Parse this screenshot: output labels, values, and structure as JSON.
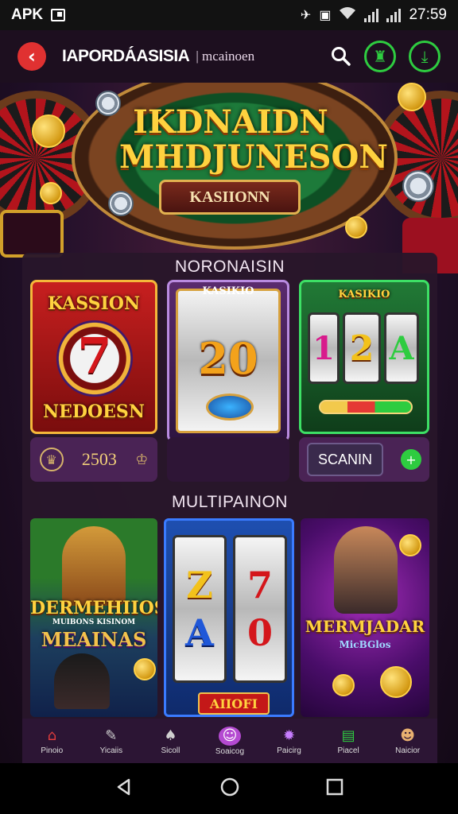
{
  "status_bar": {
    "carrier": "APK",
    "time": "27:59"
  },
  "app_bar": {
    "title": "IAPORDÁASISIA",
    "subtitle": "| mcainoen"
  },
  "hero": {
    "title_line1": "IKDNAIDN",
    "title_line2": "MHDJUNESON",
    "plaque_label": "KASIIONN"
  },
  "section1": {
    "title": "NORONAISIN",
    "card1": {
      "top_label": "KASSION",
      "digit": "7",
      "bottom_label": "NEDOESN"
    },
    "card2": {
      "top_label": "KASIKIO",
      "number": "20"
    },
    "card3": {
      "top_label": "KASIKIO",
      "digits": [
        "1",
        "2",
        "A"
      ]
    },
    "footer1_value": "2503",
    "footer3_button": "SCANIN"
  },
  "section2": {
    "title": "MULTIPAINON",
    "card1": {
      "line1": "DERMEHIIOS",
      "line2": "MUIBONS KISINOM",
      "line3": "MEAINAS"
    },
    "card2": {
      "digits": [
        "Z",
        "7",
        "A",
        "0"
      ],
      "bottom_label": "AIIOFI"
    },
    "card3": {
      "line1": "MERMJADAR",
      "line2": "MicBGlos"
    }
  },
  "bottom_nav": {
    "items": [
      {
        "label": "Pinoio",
        "icon": "home-icon",
        "color": "#e03c3c"
      },
      {
        "label": "Yicaiis",
        "icon": "gift-icon",
        "color": "#cfcfcf"
      },
      {
        "label": "Sicoll",
        "icon": "casino-icon",
        "color": "#cfcfcf"
      },
      {
        "label": "Soaicog",
        "icon": "chat-icon",
        "color": "#ffffff"
      },
      {
        "label": "Paicirg",
        "icon": "gear-icon",
        "color": "#c77dff"
      },
      {
        "label": "Piacel",
        "icon": "cash-icon",
        "color": "#2ecc40"
      },
      {
        "label": "Naicior",
        "icon": "profile-icon",
        "color": "#e8b070"
      }
    ]
  },
  "colors": {
    "accent_red": "#e03131",
    "accent_green": "#2ecc40",
    "gold": "#ffd23f"
  }
}
